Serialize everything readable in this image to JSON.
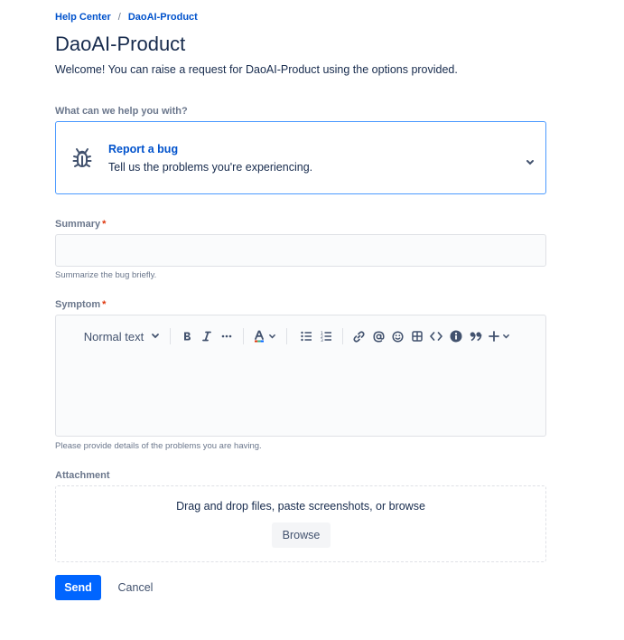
{
  "breadcrumb": {
    "items": [
      "Help Center",
      "DaoAI-Product"
    ],
    "separator": "/"
  },
  "header": {
    "title": "DaoAI-Product",
    "welcome": "Welcome! You can raise a request for DaoAI-Product using the options provided."
  },
  "request_type": {
    "label": "What can we help you with?",
    "selected_name": "Report a bug",
    "selected_description": "Tell us the problems you're experiencing.",
    "icon": "bug-icon"
  },
  "summary": {
    "label": "Summary",
    "required_mark": "*",
    "value": "",
    "helper": "Summarize the bug briefly."
  },
  "symptom": {
    "label": "Symptom",
    "required_mark": "*",
    "helper": "Please provide details of the problems you are having.",
    "toolbar": {
      "text_style": "Normal text",
      "icons": [
        "bold-icon",
        "italic-icon",
        "more-formatting-icon",
        "text-color-icon",
        "bullet-list-icon",
        "numbered-list-icon",
        "link-icon",
        "mention-icon",
        "emoji-icon",
        "table-icon",
        "code-icon",
        "info-icon",
        "quote-icon",
        "insert-icon"
      ]
    }
  },
  "attachment": {
    "label": "Attachment",
    "drop_text": "Drag and drop files, paste screenshots, or browse",
    "browse_label": "Browse"
  },
  "actions": {
    "send_label": "Send",
    "cancel_label": "Cancel"
  },
  "colors": {
    "accent": "#0052cc",
    "primary_button": "#0065ff",
    "focus_border": "#4c9aff",
    "required": "#de350b"
  }
}
